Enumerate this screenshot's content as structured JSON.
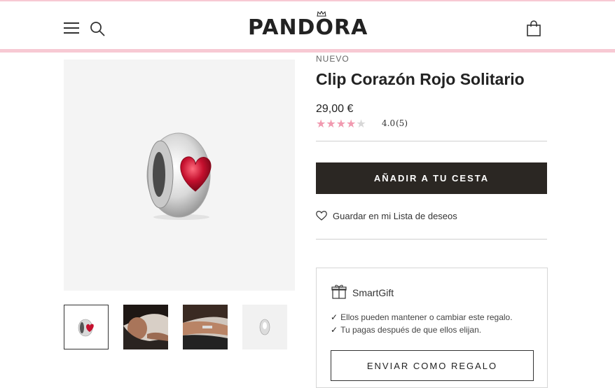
{
  "header": {
    "brand": "PANDORA",
    "icons": [
      "menu-icon",
      "search-icon",
      "bag-icon"
    ],
    "accent_color": "#f7c9d3"
  },
  "product": {
    "badge": "NUEVO",
    "title": "Clip Corazón Rojo Solitario",
    "price": "29,00 €",
    "rating": {
      "stars_filled": 4,
      "stars_total": 5,
      "value": "4.0",
      "count": "(5)"
    },
    "add_to_cart_label": "AÑADIR A TU CESTA",
    "wishlist_label": "Guardar en mi Lista de deseos"
  },
  "gallery": {
    "thumbnails": [
      "charm-front",
      "model-face",
      "model-wrist",
      "charm-side"
    ],
    "active_index": 0
  },
  "smartgift": {
    "title": "SmartGift",
    "items": [
      "Ellos pueden mantener o cambiar este regalo.",
      "Tu pagas después de que ellos elijan."
    ],
    "check": "✓",
    "send_label": "ENVIAR COMO REGALO"
  },
  "colors": {
    "button_dark": "#2b2723",
    "star": "#f19ab0",
    "heart_red": "#c5102e"
  }
}
